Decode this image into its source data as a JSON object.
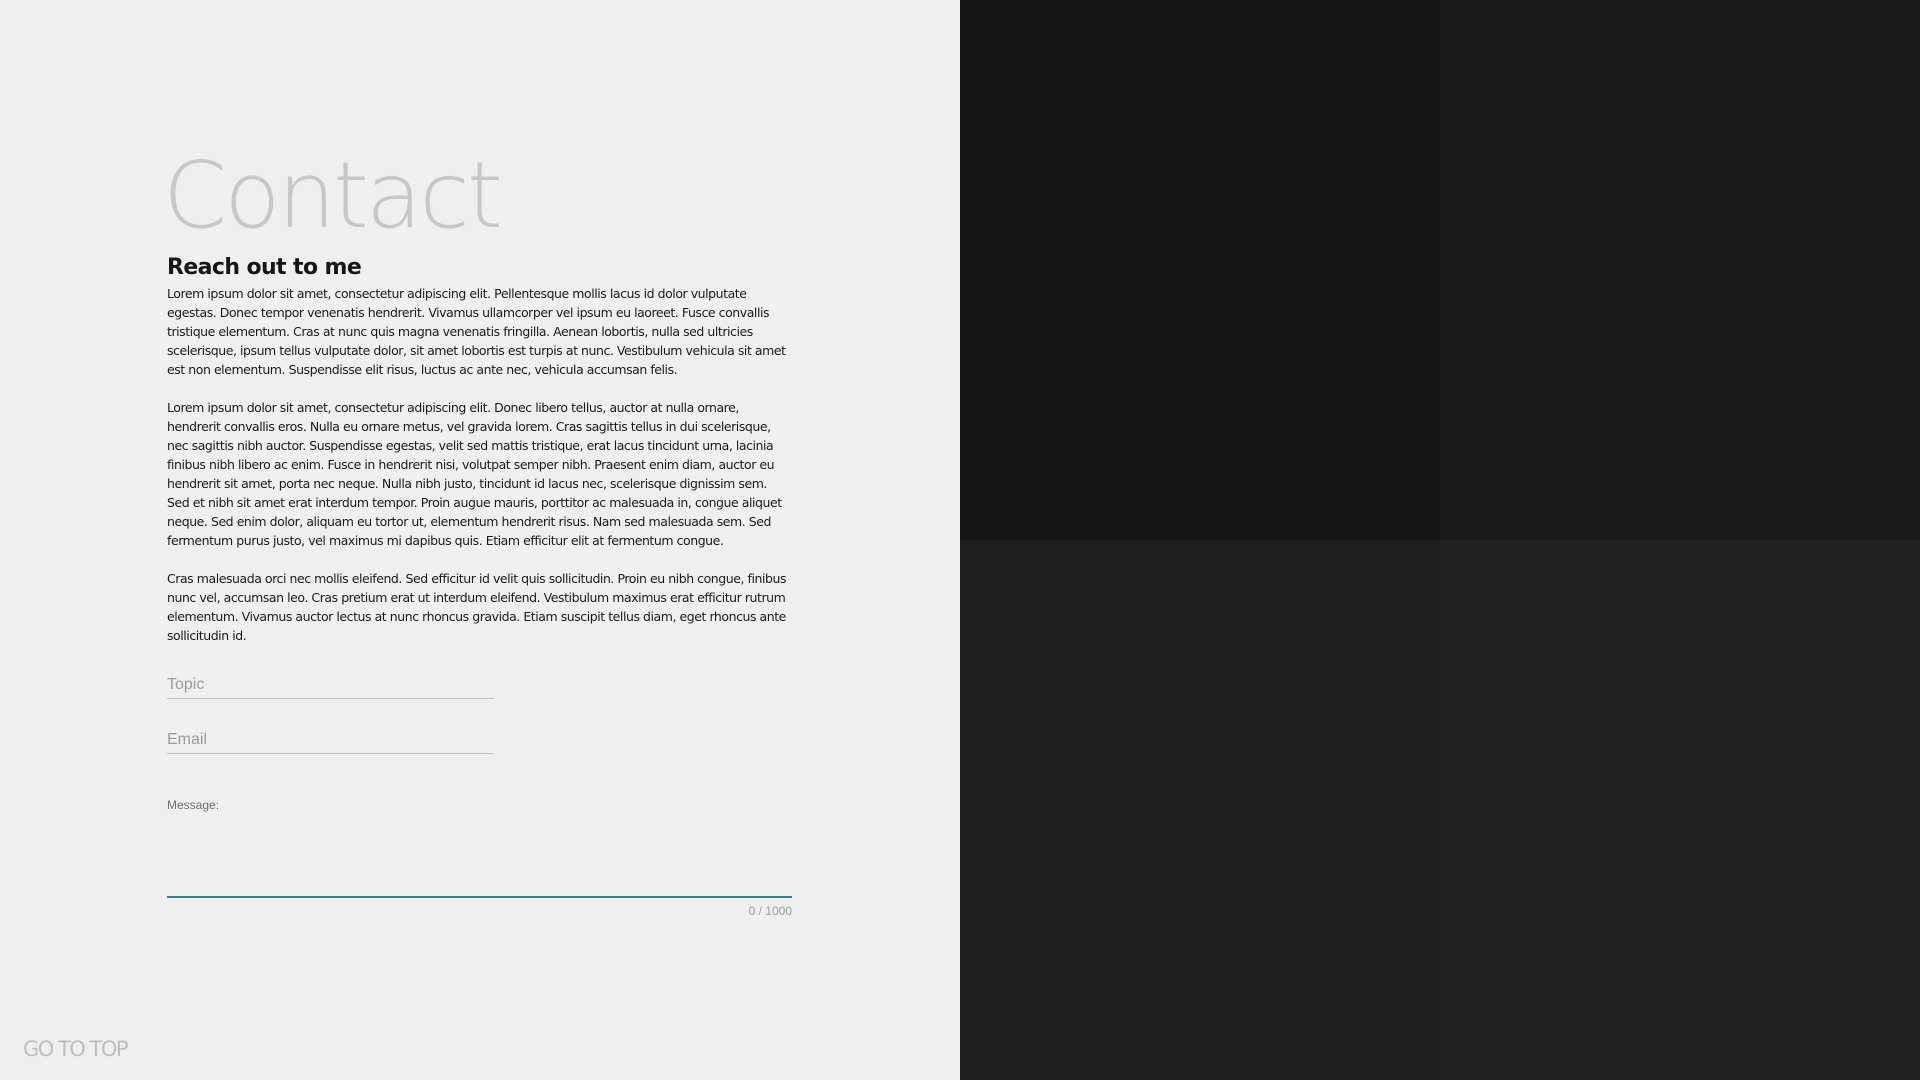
{
  "page": {
    "title": "Contact",
    "subtitle": "Reach out to me",
    "paragraphs": [
      "Lorem ipsum dolor sit amet, consectetur adipiscing elit. Pellentesque mollis lacus id dolor vulputate egestas. Donec tempor venenatis hendrerit. Vivamus ullamcorper vel ipsum eu laoreet. Fusce convallis tristique elementum. Cras at nunc quis magna venenatis fringilla. Aenean lobortis, nulla sed ultricies scelerisque, ipsum tellus vulputate dolor, sit amet lobortis est turpis at nunc. Vestibulum vehicula sit amet est non elementum. Suspendisse elit risus, luctus ac ante nec, vehicula accumsan felis.",
      "Lorem ipsum dolor sit amet, consectetur adipiscing elit. Donec libero tellus, auctor at nulla ornare, hendrerit convallis eros. Nulla eu ornare metus, vel gravida lorem. Cras sagittis tellus in dui scelerisque, nec sagittis nibh auctor. Suspendisse egestas, velit sed mattis tristique, erat lacus tincidunt urna, lacinia finibus nibh libero ac enim. Fusce in hendrerit nisi, volutpat semper nibh. Praesent enim diam, auctor eu hendrerit sit amet, porta nec neque. Nulla nibh justo, tincidunt id lacus nec, scelerisque dignissim sem. Sed et nibh sit amet erat interdum tempor. Proin augue mauris, porttitor ac malesuada in, congue aliquet neque. Sed enim dolor, aliquam eu tortor ut, elementum hendrerit risus. Nam sed malesuada sem. Sed fermentum purus justo, vel maximus mi dapibus quis. Etiam efficitur elit at fermentum congue.",
      "Cras malesuada orci nec mollis eleifend. Sed efficitur id velit quis sollicitudin. Proin eu nibh congue, finibus nunc vel, accumsan leo. Cras pretium erat ut interdum eleifend. Vestibulum maximus erat efficitur rutrum elementum. Vivamus auctor lectus at nunc rhoncus gravida. Etiam suscipit tellus diam, eget rhoncus ante sollicitudin id."
    ]
  },
  "form": {
    "topic": {
      "placeholder": "Topic",
      "value": ""
    },
    "email": {
      "placeholder": "Email",
      "value": ""
    },
    "message": {
      "label": "Message:",
      "value": "",
      "counter": "0 / 1000"
    }
  },
  "nav": {
    "go_to_top": "GO TO TOP"
  },
  "colors": {
    "left_background": "#efefef",
    "right_tiles": [
      "#161616",
      "#1b1b1b",
      "#1e1e1e",
      "#222222"
    ],
    "accent_underline": "#2b8a8a"
  }
}
